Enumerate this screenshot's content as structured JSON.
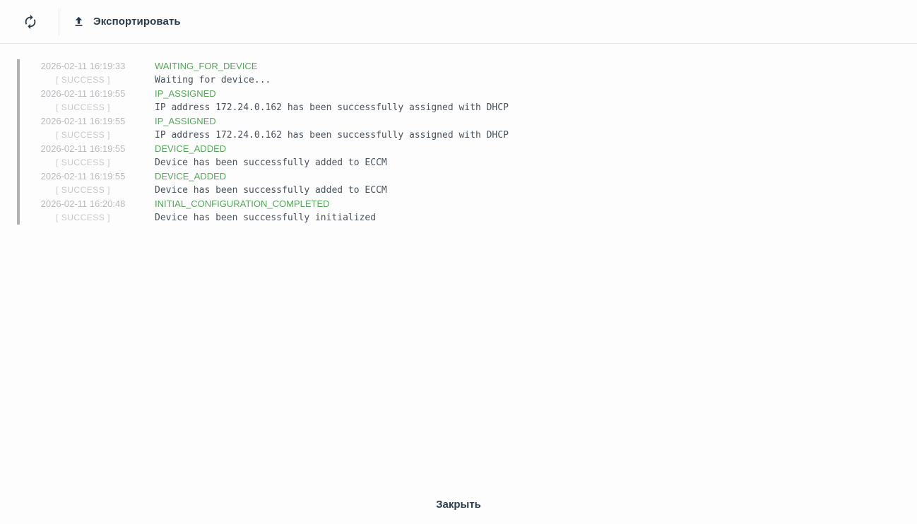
{
  "toolbar": {
    "export_label": "Экспортировать",
    "icons": {
      "refresh": "refresh-icon",
      "upload": "upload-icon"
    }
  },
  "footer": {
    "close_label": "Закрыть"
  },
  "log": {
    "entries": [
      {
        "timestamp": "2026-02-11 16:19:33",
        "status": "[ SUCCESS ]",
        "event": "WAITING_FOR_DEVICE",
        "message": "Waiting for device..."
      },
      {
        "timestamp": "2026-02-11 16:19:55",
        "status": "[ SUCCESS ]",
        "event": "IP_ASSIGNED",
        "message": "IP address 172.24.0.162 has been successfully assigned with DHCP"
      },
      {
        "timestamp": "2026-02-11 16:19:55",
        "status": "[ SUCCESS ]",
        "event": "IP_ASSIGNED",
        "message": "IP address 172.24.0.162 has been successfully assigned with DHCP"
      },
      {
        "timestamp": "2026-02-11 16:19:55",
        "status": "[ SUCCESS ]",
        "event": "DEVICE_ADDED",
        "message": "Device has been successfully added to ECCM"
      },
      {
        "timestamp": "2026-02-11 16:19:55",
        "status": "[ SUCCESS ]",
        "event": "DEVICE_ADDED",
        "message": "Device has been successfully added to ECCM"
      },
      {
        "timestamp": "2026-02-11 16:20:48",
        "status": "[ SUCCESS ]",
        "event": "INITIAL_CONFIGURATION_COMPLETED",
        "message": "Device has been successfully initialized"
      }
    ]
  },
  "colors": {
    "event_green": "#55a65a",
    "toolbar_text": "#2c3b49",
    "timestamp_gray": "#b8bbbe",
    "status_gray": "#c6c9cd",
    "message_text": "#4a525a",
    "timeline_bar": "#b1b1b3",
    "divider": "#e8e8eb"
  }
}
